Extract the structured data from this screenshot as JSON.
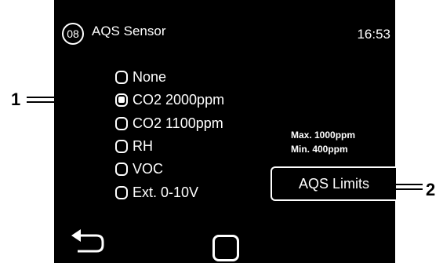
{
  "header": {
    "page_number": "08",
    "title": "AQS Sensor",
    "time": "16:53"
  },
  "sensor_options": {
    "selected_index": 1,
    "items": [
      {
        "label": "None"
      },
      {
        "label": "CO2 2000ppm"
      },
      {
        "label": "CO2 1100ppm"
      },
      {
        "label": "RH"
      },
      {
        "label": "VOC"
      },
      {
        "label": "Ext. 0-10V"
      }
    ]
  },
  "limits": {
    "max_text": "Max. 1000ppm",
    "min_text": "Min. 400ppm",
    "button_label": "AQS Limits"
  },
  "footer": {
    "back_icon": "back-arrow-icon",
    "home_icon": "square-icon"
  },
  "callouts": {
    "one": "1",
    "two": "2"
  },
  "colors": {
    "screen_bg": "#000000",
    "foreground": "#ffffff",
    "page_bg": "#ffffff"
  }
}
